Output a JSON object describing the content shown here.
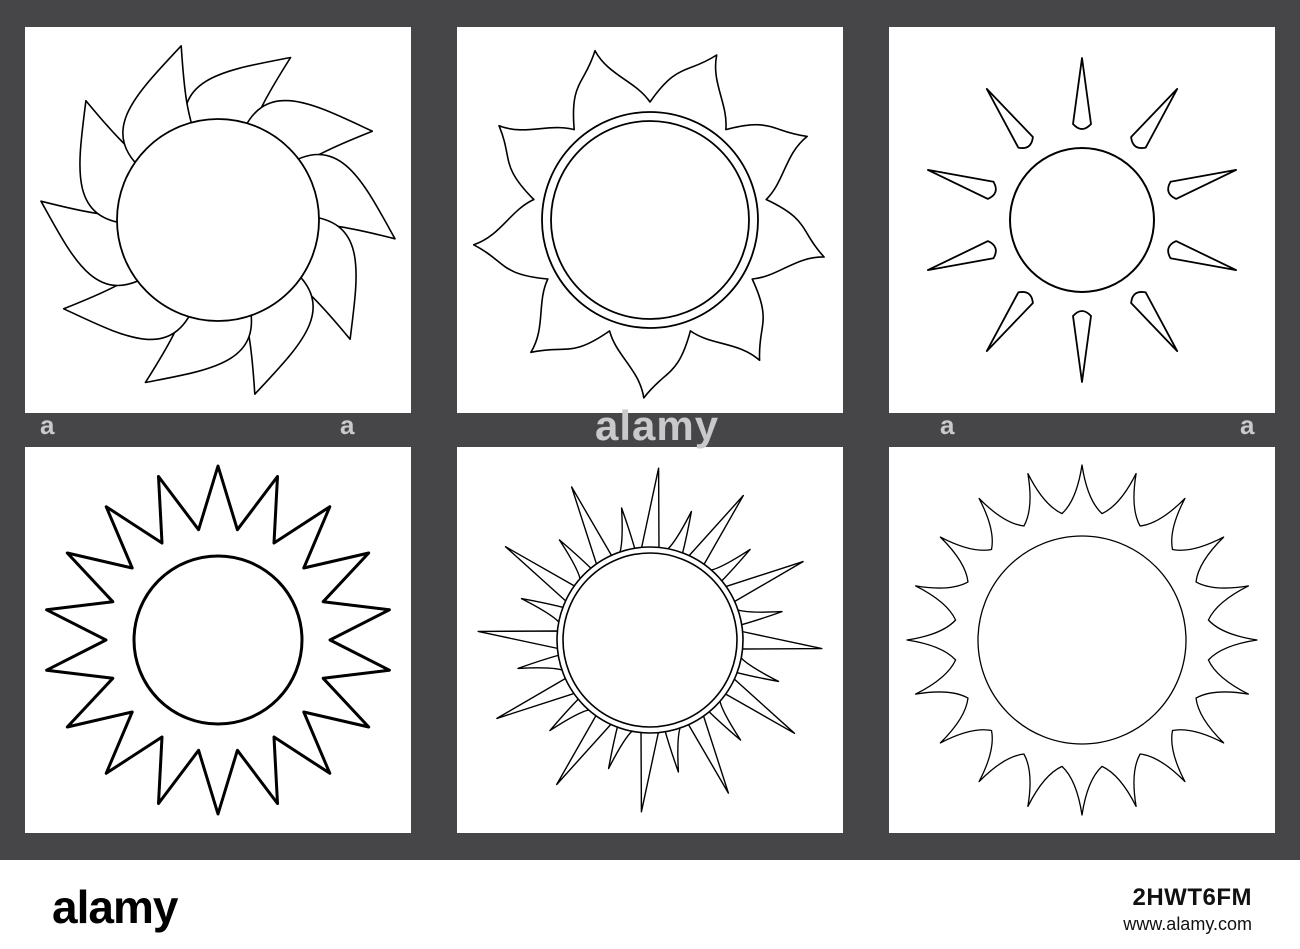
{
  "colors": {
    "background": "#464648",
    "panel": "#ffffff",
    "stroke": "#000000",
    "watermark": "#c9c9cb"
  },
  "panels": [
    {
      "style": "curved-flame-rays",
      "ray_count": 10
    },
    {
      "style": "wavy-flame-double-ring",
      "ray_count": 9
    },
    {
      "style": "teardrop-rays",
      "ray_count": 10
    },
    {
      "style": "zigzag-star",
      "ray_count": 18
    },
    {
      "style": "spiky-double-ring",
      "ray_count": 24
    },
    {
      "style": "curved-spike-rays",
      "ray_count": 20
    }
  ],
  "watermark": {
    "mark_small": "a",
    "mark_big": "alamy"
  },
  "footer": {
    "logo": "alamy",
    "image_id": "2HWT6FM",
    "site": "www.alamy.com"
  }
}
